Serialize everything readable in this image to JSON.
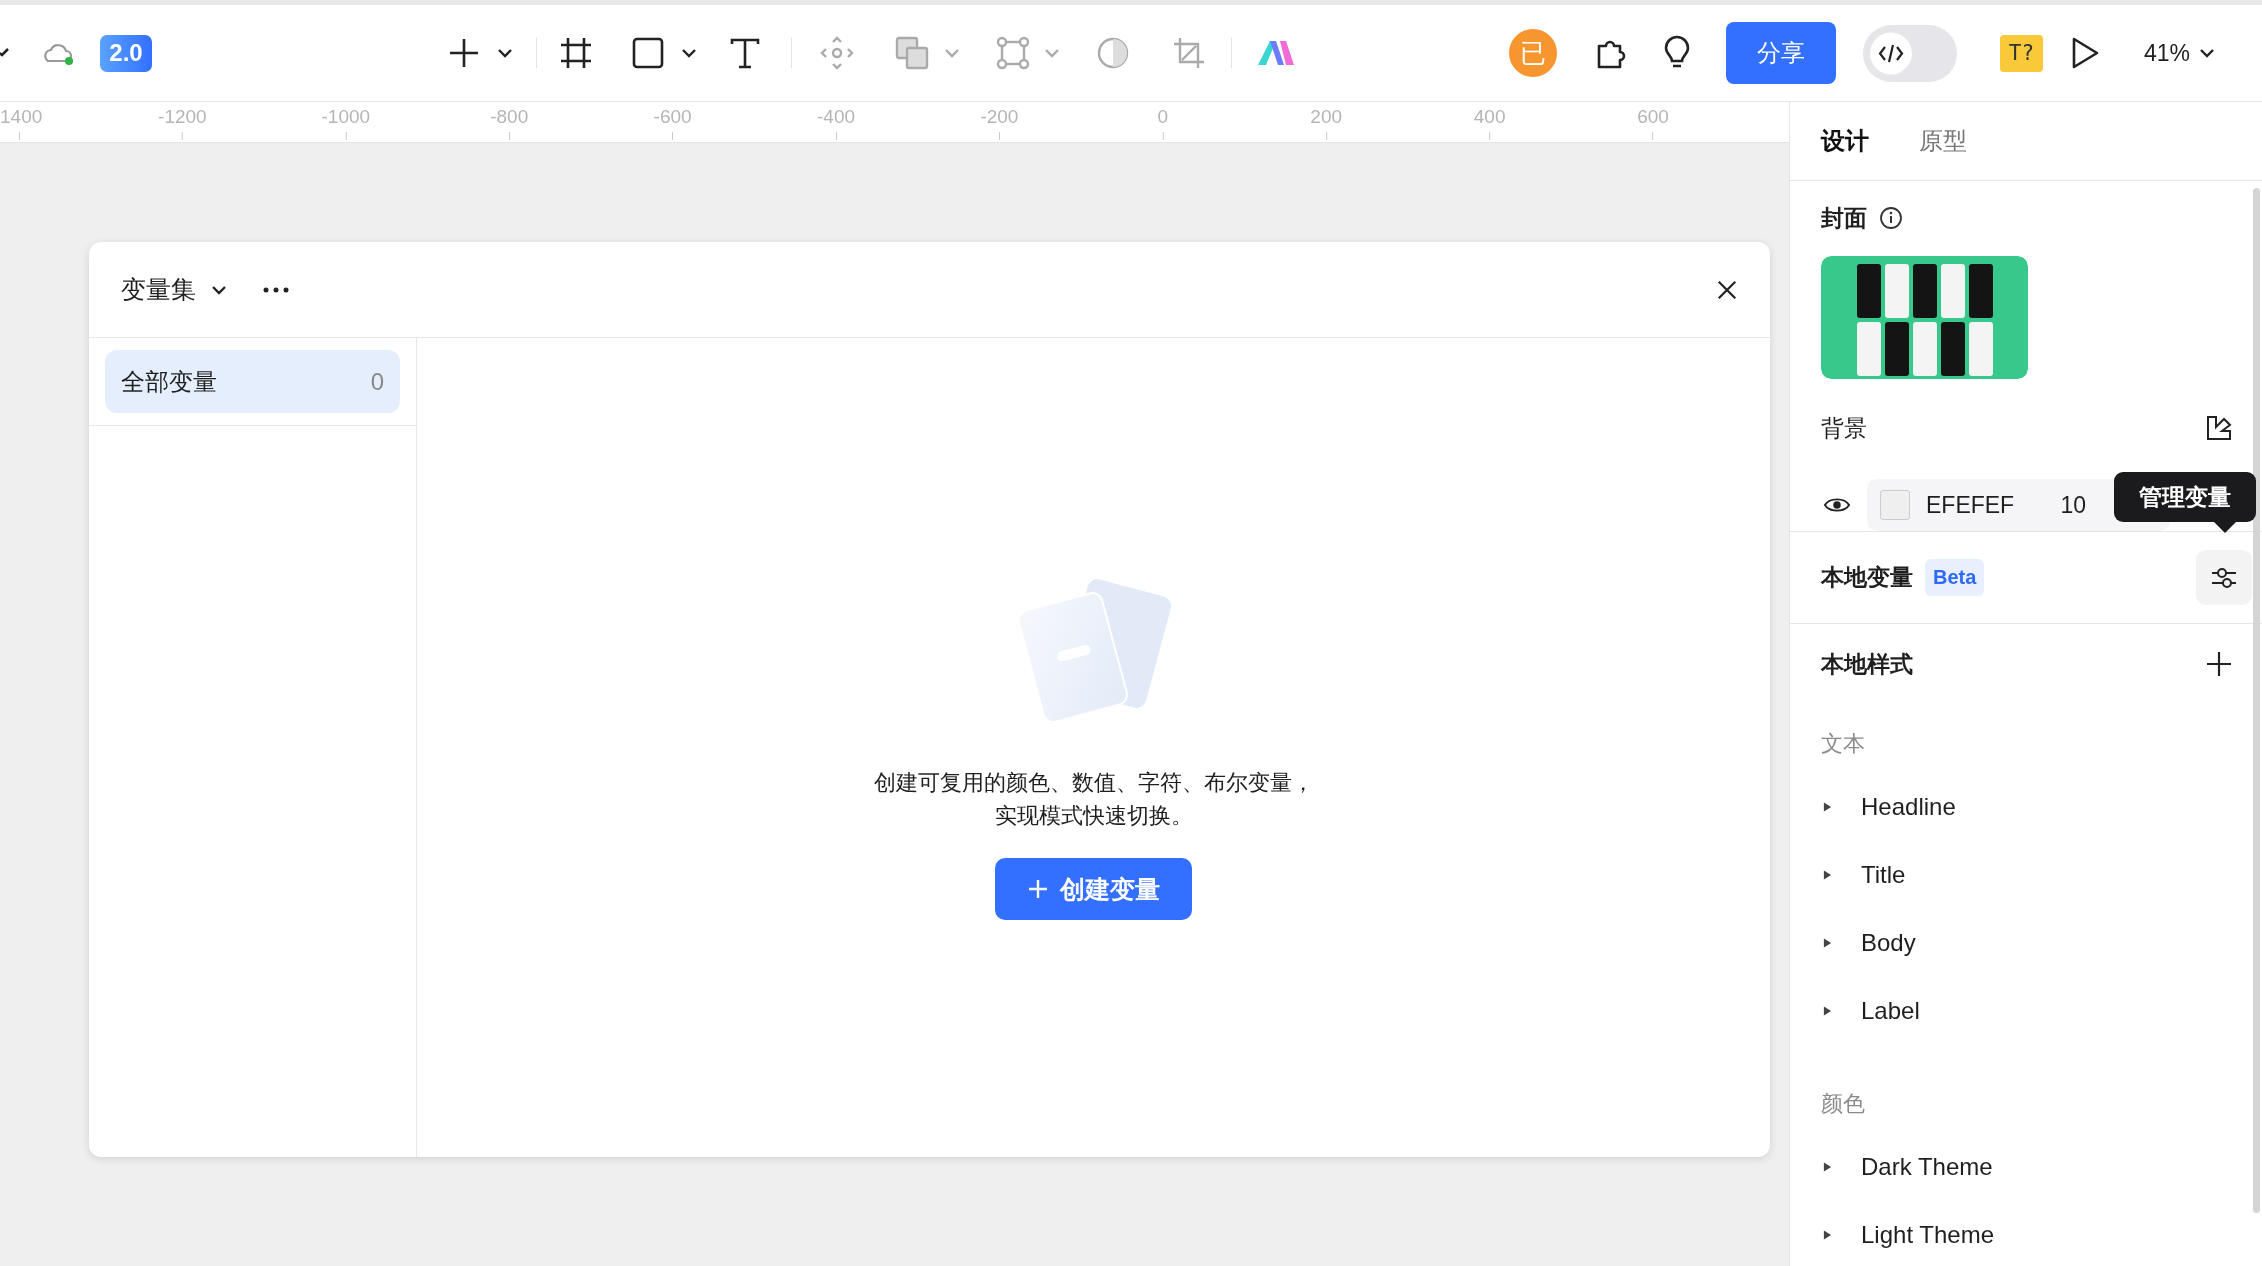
{
  "toolbar": {
    "version_badge": "2.0",
    "avatar": "已",
    "share_button": "分享",
    "dev_mode": {
      "on": false
    },
    "font_badge": "T?",
    "zoom": "41%"
  },
  "ruler": {
    "ticks": [
      "1400",
      "-1200",
      "-1000",
      "-800",
      "-600",
      "-400",
      "-200",
      "0",
      "200",
      "400",
      "600"
    ]
  },
  "dialog": {
    "title": "变量集",
    "collections": [
      {
        "label": "全部变量",
        "count": "0",
        "selected": true
      }
    ],
    "empty_message": [
      "创建可复用的颜色、数值、字符、布尔变量，",
      "实现模式快速切换。"
    ],
    "create_button": "创建变量"
  },
  "inspector": {
    "tabs": [
      {
        "label": "设计",
        "selected": true
      },
      {
        "label": "原型",
        "selected": false
      }
    ],
    "cover": {
      "title": "封面"
    },
    "background": {
      "title": "背景",
      "visible": true,
      "hex": "EFEFEF",
      "opacity": "10"
    },
    "tooltip": "管理变量",
    "local_variables": {
      "title": "本地变量",
      "badge": "Beta"
    },
    "local_styles": {
      "title": "本地样式",
      "groups": [
        {
          "title": "文本",
          "items": [
            {
              "label": "Headline",
              "expanded": false
            },
            {
              "label": "Title",
              "expanded": false
            },
            {
              "label": "Body",
              "expanded": false
            },
            {
              "label": "Label",
              "expanded": false
            }
          ]
        },
        {
          "title": "颜色",
          "items": [
            {
              "label": "Dark Theme",
              "expanded": false
            },
            {
              "label": "Light Theme",
              "expanded": false
            }
          ]
        }
      ]
    }
  }
}
